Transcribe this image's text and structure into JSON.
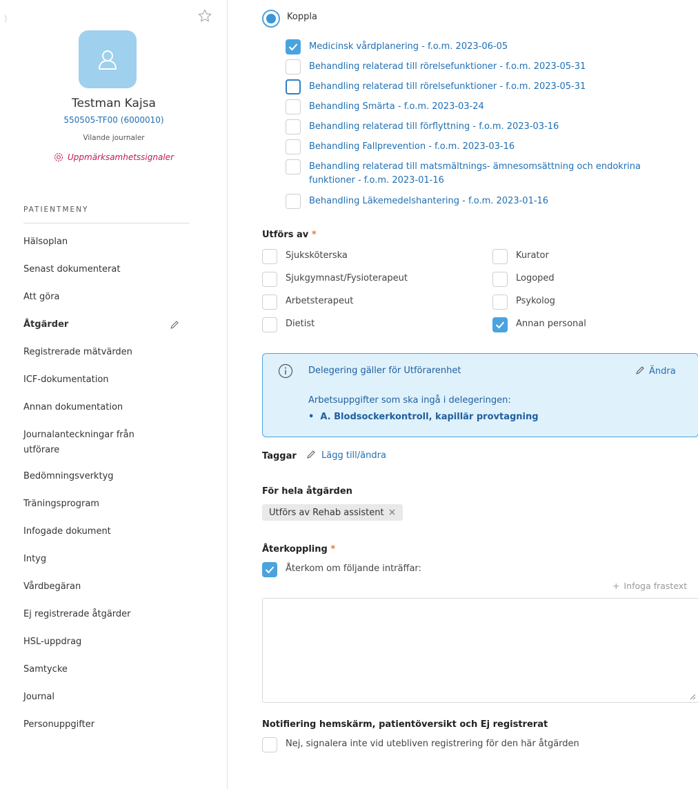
{
  "patient": {
    "name": "Testman Kajsa",
    "id": "550505-TF00 (6000010)",
    "journal_status": "Vilande journaler",
    "signal_link": "Uppmärksamhetssignaler"
  },
  "sidebar": {
    "menu_title": "PATIENTMENY",
    "items": [
      {
        "label": "Hälsoplan"
      },
      {
        "label": "Senast dokumenterat"
      },
      {
        "label": "Att göra"
      },
      {
        "label": "Åtgärder"
      },
      {
        "label": "Registrerade mätvärden"
      },
      {
        "label": "ICF-dokumentation"
      },
      {
        "label": "Annan dokumentation"
      },
      {
        "label": "Journalanteckningar från utförare"
      },
      {
        "label": "Bedömningsverktyg"
      },
      {
        "label": "Träningsprogram"
      },
      {
        "label": "Infogade dokument"
      },
      {
        "label": "Intyg"
      },
      {
        "label": "Vårdbegäran"
      },
      {
        "label": "Ej registrerade åtgärder"
      },
      {
        "label": "HSL-uppdrag"
      },
      {
        "label": "Samtycke"
      },
      {
        "label": "Journal"
      },
      {
        "label": "Personuppgifter"
      }
    ],
    "active_index": 3
  },
  "main": {
    "koppla": {
      "label": "Koppla",
      "selected": true,
      "items": [
        {
          "label": "Medicinsk vårdplanering - f.o.m. 2023-06-05",
          "checked": true
        },
        {
          "label": "Behandling relaterad till rörelsefunktioner - f.o.m. 2023-05-31",
          "checked": false
        },
        {
          "label": "Behandling relaterad till rörelsefunktioner - f.o.m. 2023-05-31",
          "checked": false
        },
        {
          "label": "Behandling Smärta - f.o.m. 2023-03-24",
          "checked": false
        },
        {
          "label": "Behandling relaterad till förflyttning - f.o.m. 2023-03-16",
          "checked": false
        },
        {
          "label": "Behandling Fallprevention - f.o.m. 2023-03-16",
          "checked": false
        },
        {
          "label": "Behandling relaterad till matsmältnings- ämnesomsättning och endokrina funktioner - f.o.m. 2023-01-16",
          "checked": false
        },
        {
          "label": "Behandling Läkemedelshantering - f.o.m. 2023-01-16",
          "checked": false
        }
      ]
    },
    "utfors_av": {
      "label": "Utförs av",
      "required_mark": "*",
      "options": [
        {
          "label": "Sjuksköterska",
          "checked": false
        },
        {
          "label": "Kurator",
          "checked": false
        },
        {
          "label": "Sjukgymnast/Fysioterapeut",
          "checked": false
        },
        {
          "label": "Logoped",
          "checked": false
        },
        {
          "label": "Arbetsterapeut",
          "checked": false
        },
        {
          "label": "Psykolog",
          "checked": false
        },
        {
          "label": "Dietist",
          "checked": false
        },
        {
          "label": "Annan personal",
          "checked": true
        }
      ]
    },
    "delegation": {
      "title": "Delegering gäller för Utförarenhet",
      "edit_label": "Ändra",
      "subtitle": "Arbetsuppgifter som ska ingå i delegeringen:",
      "tasks": [
        "A. Blodsockerkontroll, kapillär provtagning"
      ]
    },
    "tags": {
      "label": "Taggar",
      "edit_label": "Lägg till/ändra"
    },
    "whole_action": {
      "label": "För hela åtgärden",
      "chip": "Utförs av Rehab assistent",
      "chip_remove": "×"
    },
    "feedback": {
      "label": "Återkoppling",
      "required_mark": "*",
      "checkbox_label": "Återkom om följande inträffar:",
      "checked": true,
      "insert_phrase": "Infoga frastext",
      "text_value": ""
    },
    "notification": {
      "label": "Notifiering hemskärm, patientöversikt och Ej registrerat",
      "checkbox_label": "Nej, signalera inte vid utebliven registrering för den här åtgärden",
      "checked": false
    }
  },
  "colors": {
    "accent": "#4aa3df",
    "link": "#1f6fb3",
    "info_bg": "#dff1fb",
    "required": "#e8773a",
    "signal": "#c2185b",
    "avatar_bg": "#9fd0ee"
  }
}
